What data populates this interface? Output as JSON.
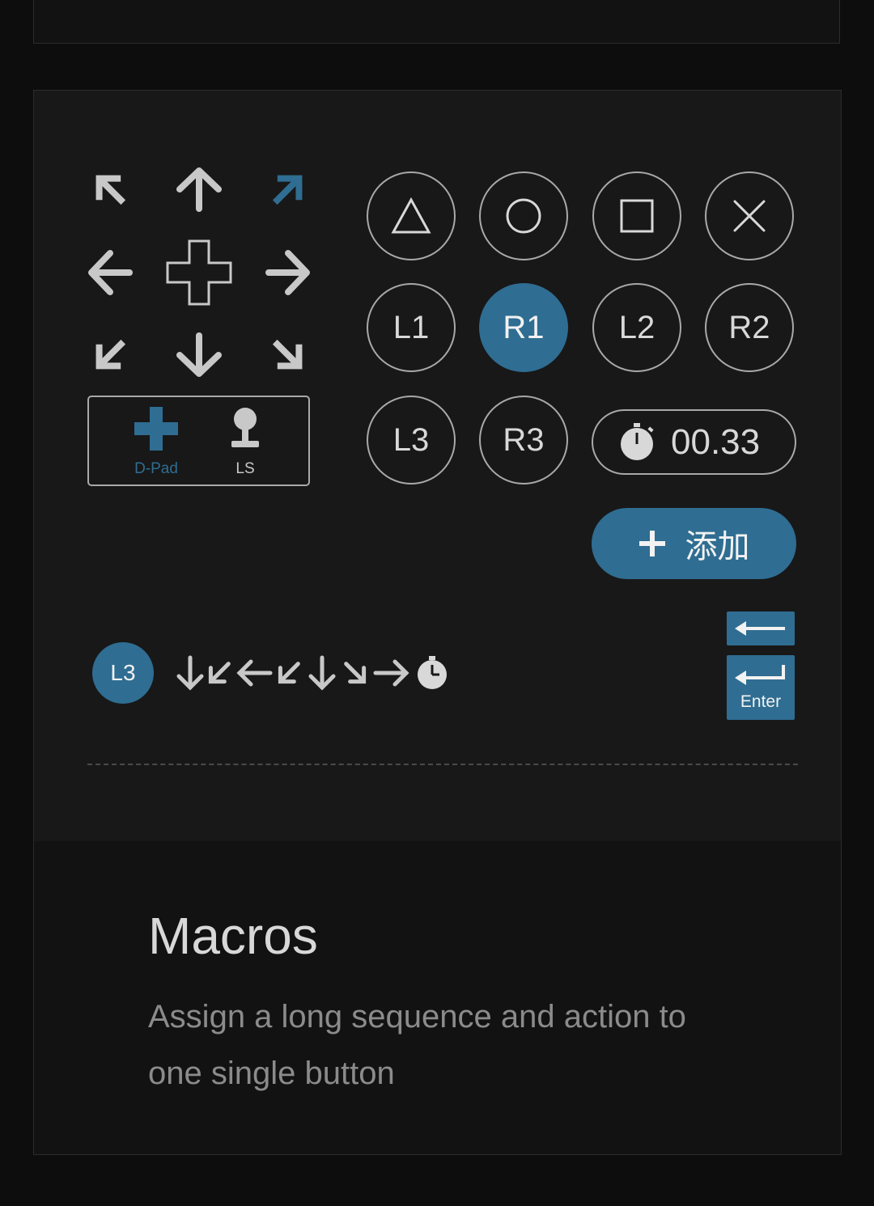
{
  "dpad": {
    "arrows": [
      "up-left",
      "up",
      "up-right",
      "left",
      "center",
      "right",
      "down-left",
      "down",
      "down-right"
    ],
    "highlighted_arrow": "up-right"
  },
  "stick_selector": {
    "items": [
      {
        "label": "D-Pad",
        "icon": "dpad-icon",
        "selected": true
      },
      {
        "label": "LS",
        "icon": "joystick-icon",
        "selected": false
      }
    ]
  },
  "face_buttons": {
    "shapes": [
      "triangle",
      "circle",
      "square",
      "cross"
    ],
    "shoulder": [
      {
        "label": "L1",
        "active": false
      },
      {
        "label": "R1",
        "active": true
      },
      {
        "label": "L2",
        "active": false
      },
      {
        "label": "R2",
        "active": false
      }
    ],
    "sticks": [
      {
        "label": "L3",
        "active": false
      },
      {
        "label": "R3",
        "active": false
      }
    ]
  },
  "timer": {
    "value": "00.33",
    "icon": "stopwatch-icon"
  },
  "add_button": {
    "label": "添加",
    "icon": "plus-icon"
  },
  "sequence": {
    "trigger": "L3",
    "steps": [
      "down",
      "down-left",
      "left",
      "down-left",
      "down",
      "down-right",
      "right",
      "timer"
    ]
  },
  "keys": {
    "backspace_icon": "backspace-icon",
    "enter_label": "Enter"
  },
  "feature": {
    "title": "Macros",
    "description": "Assign a long sequence and action to one single button"
  },
  "colors": {
    "accent": "#2f6d92",
    "outline": "#a9a9a9",
    "icon": "#c8c8c8",
    "panel": "#181818",
    "background": "#0d0d0d"
  }
}
